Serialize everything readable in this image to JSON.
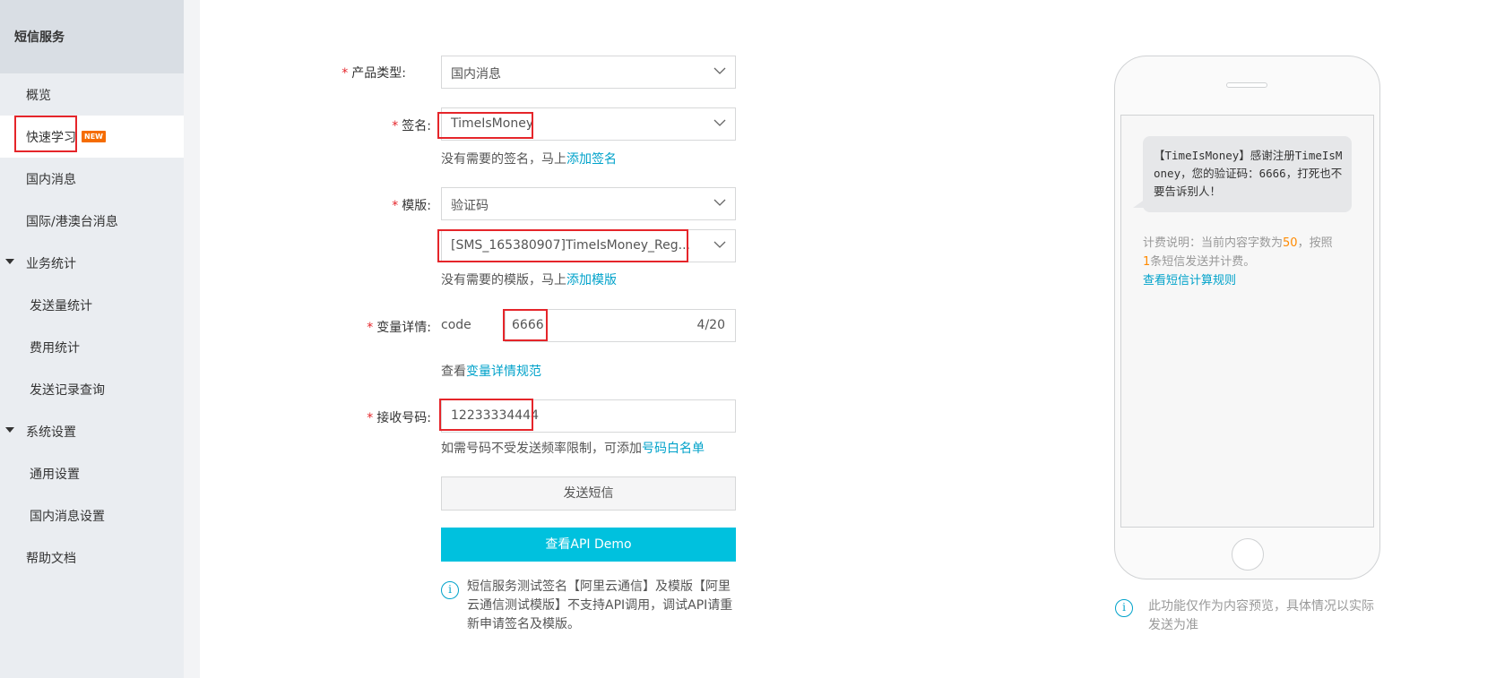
{
  "sidebar": {
    "title": "短信服务",
    "items": [
      {
        "label": "概览"
      },
      {
        "label": "快速学习",
        "badge": "NEW"
      },
      {
        "label": "国内消息"
      },
      {
        "label": "国际/港澳台消息"
      },
      {
        "label": "业务统计"
      },
      {
        "label": "发送量统计"
      },
      {
        "label": "费用统计"
      },
      {
        "label": "发送记录查询"
      },
      {
        "label": "系统设置"
      },
      {
        "label": "通用设置"
      },
      {
        "label": "国内消息设置"
      },
      {
        "label": "帮助文档"
      }
    ]
  },
  "form": {
    "required_mark": "*",
    "product_type": {
      "label": "产品类型:",
      "value": "国内消息"
    },
    "signature": {
      "label": "签名:",
      "value": "TimeIsMoney",
      "hint": "没有需要的签名，马上",
      "hint_link": "添加签名"
    },
    "template": {
      "label": "模版:",
      "type_value": "验证码",
      "value": "[SMS_165380907]TimeIsMoney_Reg...",
      "hint": "没有需要的模版，马上",
      "hint_link": "添加模版"
    },
    "variables": {
      "label": "变量详情:",
      "name": "code",
      "value": "6666",
      "count": "4/20",
      "hint": "查看",
      "hint_link": "变量详情规范"
    },
    "phone": {
      "label": "接收号码:",
      "value": "12233334444",
      "hint": "如需号码不受发送频率限制，可添加",
      "hint_link": "号码白名单"
    },
    "send_button": "发送短信",
    "api_button": "查看API Demo",
    "note_line1": "短信服务测试签名【阿里云通信】及模版【阿里",
    "note_line2": "云通信测试模版】不支持API调用，调试API请重",
    "note_line3": "新申请签名及模版。"
  },
  "preview": {
    "message": "【TimeIsMoney】感谢注册TimeIsMoney，您的验证码：6666，打死也不要告诉别人！",
    "fee_prefix": "计费说明：当前内容字数为",
    "fee_chars": "50",
    "fee_mid": "，按照",
    "fee_count": "1",
    "fee_suffix": "条短信发送并计费。",
    "fee_link": "查看短信计算规则",
    "disclaimer_line1": "此功能仅作为内容预览，具体情况以实际",
    "disclaimer_line2": "发送为准"
  },
  "colors": {
    "accent": "#00c1de",
    "link": "#00a2ca",
    "highlight": "#e5252a",
    "badge": "#f56c00"
  },
  "icons": [
    "chevron-down-icon",
    "info-icon",
    "caret-down-icon"
  ]
}
